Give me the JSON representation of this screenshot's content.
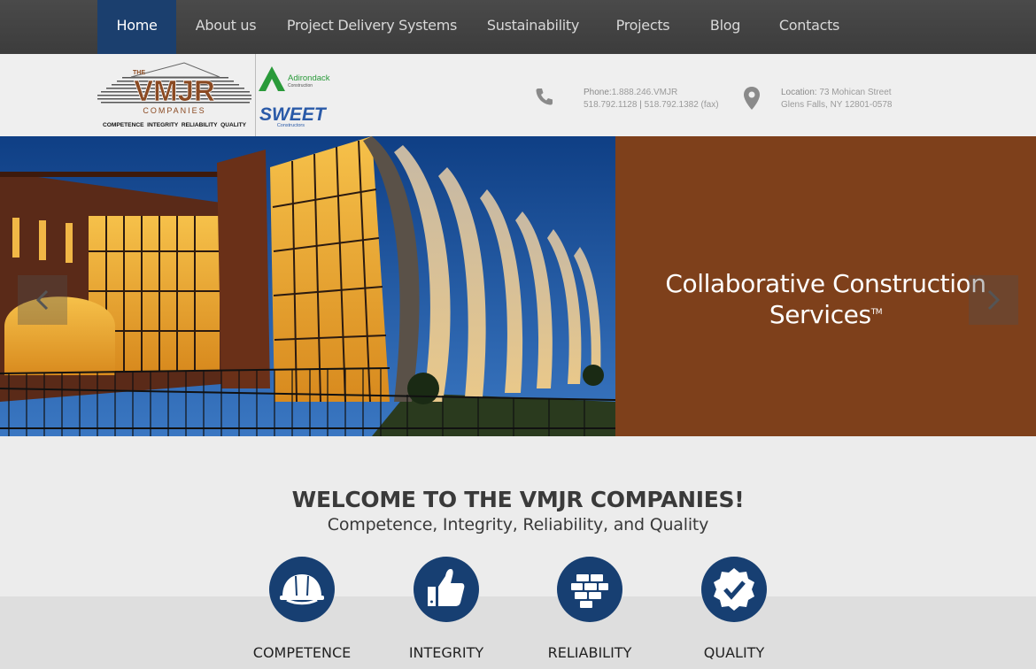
{
  "nav": {
    "items": [
      {
        "label": "Home",
        "active": true
      },
      {
        "label": "About us"
      },
      {
        "label": "Project Delivery Systems"
      },
      {
        "label": "Sustainability"
      },
      {
        "label": "Projects"
      },
      {
        "label": "Blog"
      },
      {
        "label": "Contacts"
      }
    ]
  },
  "header": {
    "logo_the": "THE",
    "logo_name": "VMJR",
    "logo_companies": "COMPANIES",
    "logo_tagline": "COMPETENCE  INTEGRITY  RELIABILITY  QUALITY",
    "logo_adk_top": "Adirondack",
    "logo_adk_bottom": "Construction",
    "logo_sweet_top": "SWEET",
    "logo_sweet_bottom": "Constructors",
    "phone_label": "Phone:",
    "phone_main": "1.888.246.VMJR",
    "phone_local": "518.792.1128",
    "phone_sep": "|",
    "phone_fax": "518.792.1382 (fax)",
    "location_label": "Location:",
    "location_street": "73 Mohican Street",
    "location_city": "Glens Falls, NY 12801-0578",
    "icons": {
      "phone": "phone-icon",
      "location": "location-pin-icon"
    }
  },
  "hero": {
    "caption_line1": "Collaborative Construction",
    "caption_line2": "Services",
    "caption_tm": "TM",
    "panel_color": "#7e401b",
    "icons": {
      "prev": "chevron-left-icon",
      "next": "chevron-right-icon"
    }
  },
  "welcome": {
    "title": "WELCOME TO THE VMJR COMPANIES!",
    "subtitle": "Competence, Integrity, Reliability, and Quality"
  },
  "values": [
    {
      "label": "COMPETENCE",
      "icon": "hard-hat-icon"
    },
    {
      "label": "INTEGRITY",
      "icon": "thumbs-up-icon"
    },
    {
      "label": "RELIABILITY",
      "icon": "brick-wall-icon"
    },
    {
      "label": "QUALITY",
      "icon": "badge-check-icon"
    }
  ],
  "colors": {
    "nav_active": "#1b3f6e",
    "circle": "#173f72",
    "brand_orange": "#8b4a22"
  }
}
